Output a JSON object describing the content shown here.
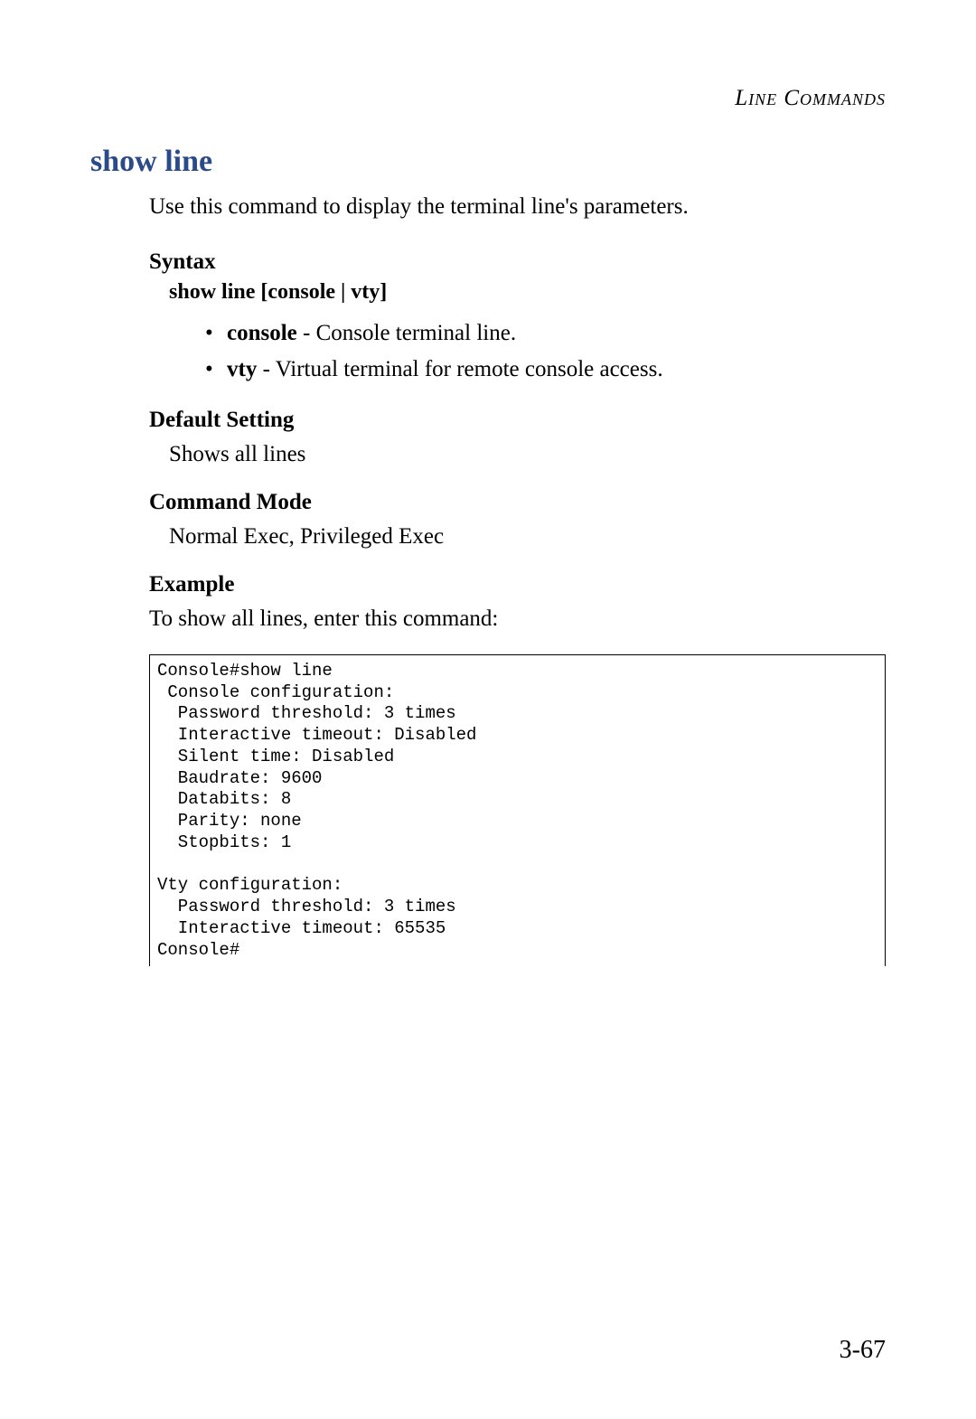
{
  "header": {
    "section_label": "Line Commands"
  },
  "title": "show line",
  "intro": "Use this command to display the terminal line's parameters.",
  "syntax": {
    "heading": "Syntax",
    "command": "show line [console | vty]",
    "params": [
      {
        "name": "console",
        "desc": " - Console terminal line."
      },
      {
        "name": "vty",
        "desc": " - Virtual terminal for remote console access."
      }
    ]
  },
  "default_setting": {
    "heading": "Default Setting",
    "text": "Shows all lines"
  },
  "command_mode": {
    "heading": "Command Mode",
    "text": "Normal Exec, Privileged Exec"
  },
  "example": {
    "heading": "Example",
    "intro": "To show all lines, enter this command:",
    "code": "Console#show line\n Console configuration:\n  Password threshold: 3 times\n  Interactive timeout: Disabled\n  Silent time: Disabled\n  Baudrate: 9600\n  Databits: 8\n  Parity: none\n  Stopbits: 1\n\nVty configuration:\n  Password threshold: 3 times\n  Interactive timeout: 65535\nConsole#"
  },
  "page_number": "3-67"
}
